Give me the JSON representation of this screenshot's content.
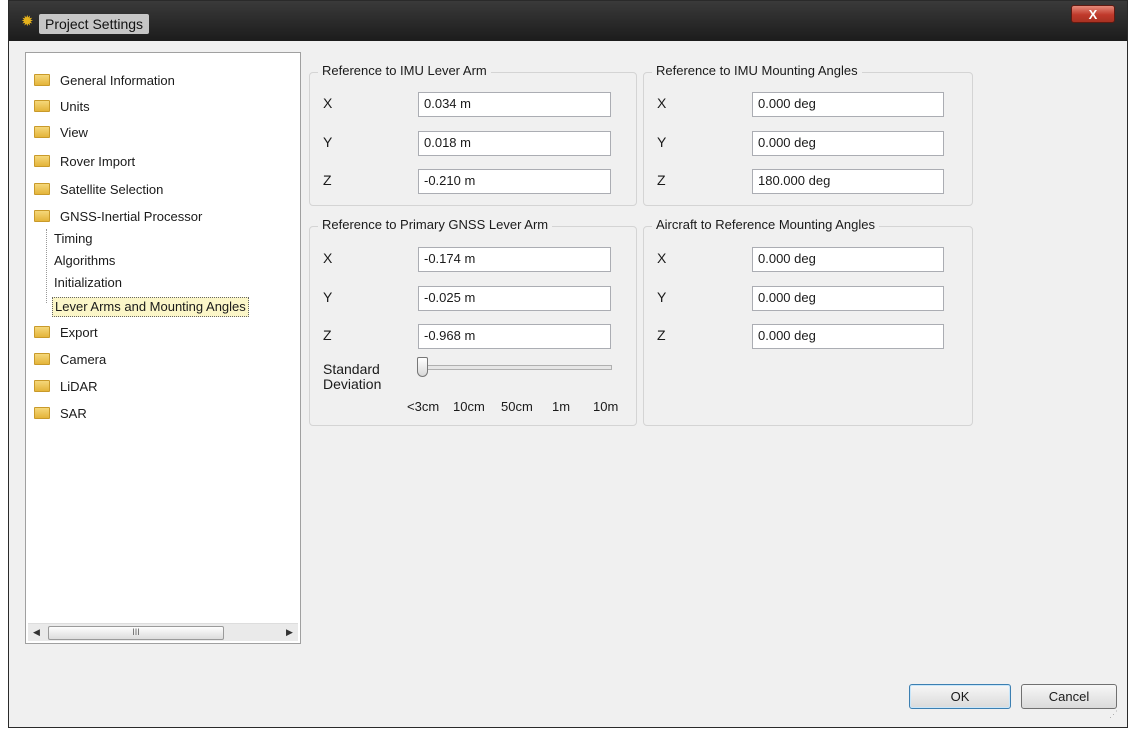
{
  "window": {
    "title": "Project Settings",
    "close_glyph": "X"
  },
  "tree": {
    "items": [
      {
        "label": "General Information"
      },
      {
        "label": "Units"
      },
      {
        "label": "View"
      },
      {
        "label": "Rover Import"
      },
      {
        "label": "Satellite Selection"
      },
      {
        "label": "GNSS-Inertial Processor"
      }
    ],
    "children": [
      {
        "label": "Timing"
      },
      {
        "label": "Algorithms"
      },
      {
        "label": "Initialization"
      },
      {
        "label": "Lever Arms and Mounting Angles",
        "selected": true
      }
    ],
    "items_after": [
      {
        "label": "Export"
      },
      {
        "label": "Camera"
      },
      {
        "label": "LiDAR"
      },
      {
        "label": "SAR"
      }
    ],
    "scroll_thumb_glyph": "III"
  },
  "groups": {
    "imu_lever_arm": {
      "title": "Reference to IMU Lever Arm",
      "x_label": "X",
      "y_label": "Y",
      "z_label": "Z",
      "x": "0.034 m",
      "y": "0.018 m",
      "z": "-0.210 m"
    },
    "imu_mounting": {
      "title": "Reference to IMU Mounting Angles",
      "x_label": "X",
      "y_label": "Y",
      "z_label": "Z",
      "x": "0.000 deg",
      "y": "0.000 deg",
      "z": "180.000 deg"
    },
    "gnss_lever_arm": {
      "title": "Reference to Primary GNSS Lever Arm",
      "x_label": "X",
      "y_label": "Y",
      "z_label": "Z",
      "x": "-0.174 m",
      "y": "-0.025 m",
      "z": "-0.968 m",
      "std_dev_label_1": "Standard",
      "std_dev_label_2": "Deviation",
      "ticks": [
        "<3cm",
        "10cm",
        "50cm",
        "1m",
        "10m"
      ],
      "selected_tick": "<3cm"
    },
    "aircraft_mounting": {
      "title": "Aircraft to Reference Mounting Angles",
      "x_label": "X",
      "y_label": "Y",
      "z_label": "Z",
      "x": "0.000 deg",
      "y": "0.000 deg",
      "z": "0.000 deg"
    }
  },
  "buttons": {
    "ok": "OK",
    "cancel": "Cancel"
  },
  "icons": {
    "title": "gear-icon",
    "folder": "folder-icon"
  },
  "colors": {
    "titlebar": "#1c1c1c",
    "close": "#c0392b",
    "folder": "#e4b43a",
    "selection": "#fbf6c8"
  }
}
